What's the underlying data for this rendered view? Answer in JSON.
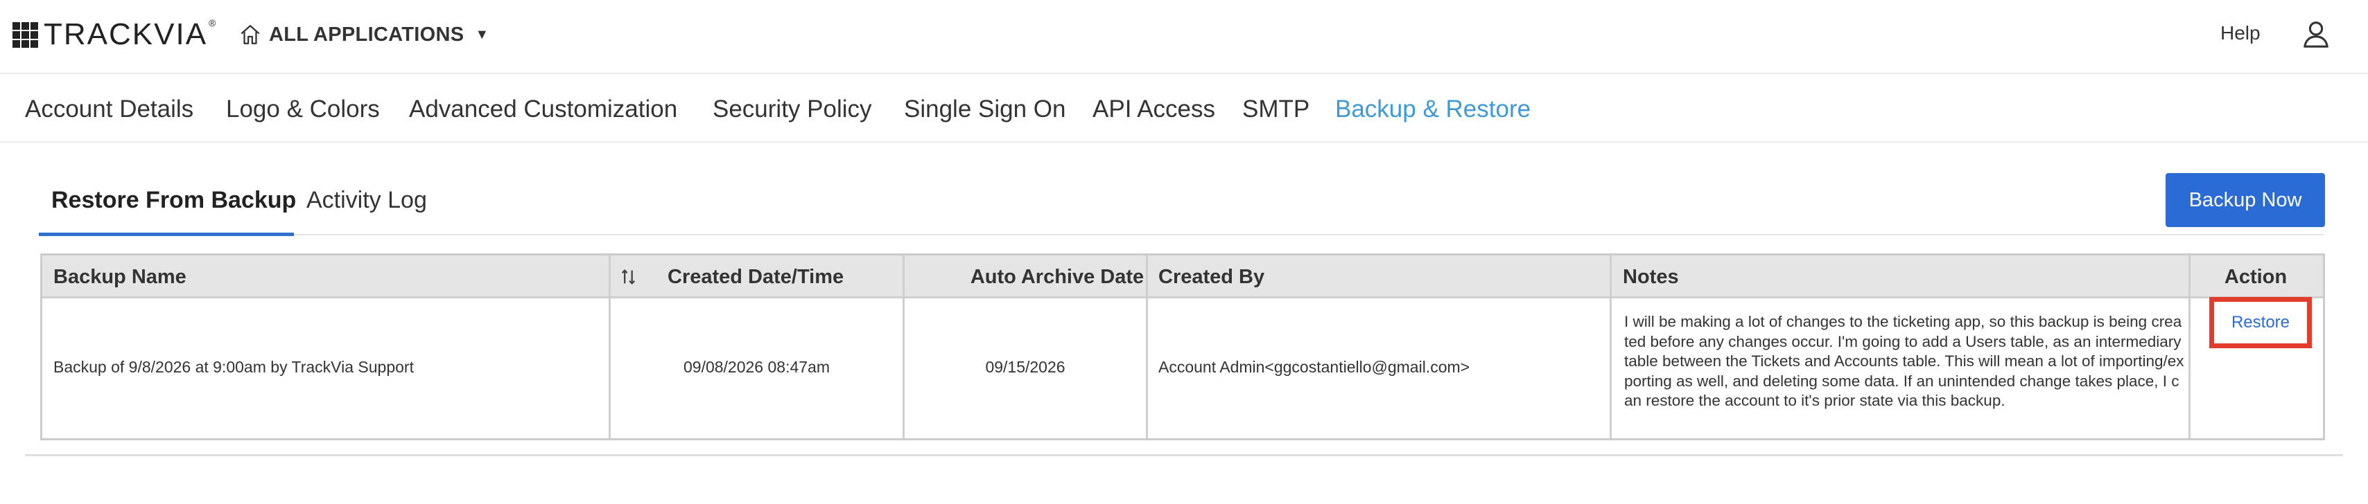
{
  "header": {
    "logo_text": "TRACKVIA",
    "logo_mark": "®",
    "apps_label": "ALL APPLICATIONS",
    "help_label": "Help"
  },
  "settings_nav": [
    {
      "label": "Account Details",
      "active": false
    },
    {
      "label": "Logo & Colors",
      "active": false
    },
    {
      "label": "Advanced Customization",
      "active": false
    },
    {
      "label": "Security Policy",
      "active": false
    },
    {
      "label": "Single Sign On",
      "active": false
    },
    {
      "label": "API Access",
      "active": false
    },
    {
      "label": "SMTP",
      "active": false
    },
    {
      "label": "Backup & Restore",
      "active": true
    }
  ],
  "subtabs": [
    {
      "label": "Restore From Backup",
      "active": true
    },
    {
      "label": "Activity Log",
      "active": false
    }
  ],
  "backup_now_label": "Backup Now",
  "table": {
    "columns": [
      "Backup Name",
      "Created Date/Time",
      "Auto Archive Date",
      "Created By",
      "Notes",
      "Action"
    ],
    "rows": [
      {
        "backup_name": "Backup of 9/8/2026 at 9:00am by TrackVia Support",
        "created": "09/08/2026 08:47am",
        "archive": "09/15/2026",
        "created_by": "Account Admin<ggcostantiello@gmail.com>",
        "notes": "I will be making a lot of changes to the ticketing app, so this backup is being created before any changes occur. I'm going to add a Users table, as an intermediary table between the Tickets and Accounts table. This will mean a lot of importing/exporting as well, and deleting some data. If an unintended change takes place, I can restore the account to it's prior state via this backup.",
        "action": "Restore"
      }
    ]
  },
  "colors": {
    "accent": "#3d9ad7",
    "button": "#2b6bd6",
    "highlight": "#e23c2c"
  }
}
